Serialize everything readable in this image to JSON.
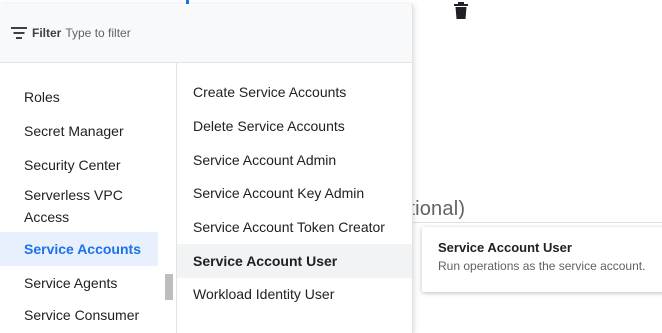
{
  "filter": {
    "label": "Filter",
    "placeholder": "Type to filter"
  },
  "icons": {
    "filter": "filter-list-icon",
    "delete": "trash-icon"
  },
  "services": [
    {
      "label": "Roles"
    },
    {
      "label": "Secret Manager"
    },
    {
      "label": "Security Center"
    },
    {
      "label": "Serverless VPC Access"
    },
    {
      "label": "Service Accounts",
      "selected": true
    },
    {
      "label": "Service Agents"
    },
    {
      "label": "Service Consumer"
    }
  ],
  "roles": [
    {
      "label": "Create Service Accounts"
    },
    {
      "label": "Delete Service Accounts"
    },
    {
      "label": "Service Account Admin"
    },
    {
      "label": "Service Account Key Admin"
    },
    {
      "label": "Service Account Token Creator"
    },
    {
      "label": "Service Account User",
      "selected": true
    },
    {
      "label": "Workload Identity User"
    }
  ],
  "background": {
    "partial_heading": "otional)"
  },
  "description": {
    "title": "Service Account User",
    "text": "Run operations as the service account."
  },
  "colors": {
    "accent": "#1a73e8",
    "selected_bg": "#e8f0fe",
    "hover_bg": "#f1f3f4"
  }
}
